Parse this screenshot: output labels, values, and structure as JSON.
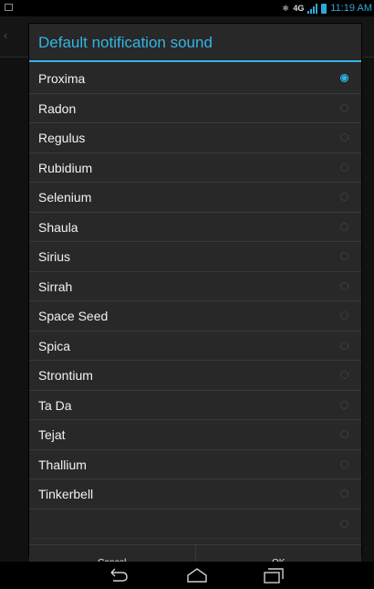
{
  "status_bar": {
    "network_label": "4G",
    "time": "11:19 AM",
    "accent_color": "#33b5e5"
  },
  "dialog": {
    "title": "Default notification sound",
    "items": [
      {
        "label": "Proxima",
        "selected": true
      },
      {
        "label": "Radon",
        "selected": false
      },
      {
        "label": "Regulus",
        "selected": false
      },
      {
        "label": "Rubidium",
        "selected": false
      },
      {
        "label": "Selenium",
        "selected": false
      },
      {
        "label": "Shaula",
        "selected": false
      },
      {
        "label": "Sirius",
        "selected": false
      },
      {
        "label": "Sirrah",
        "selected": false
      },
      {
        "label": "Space Seed",
        "selected": false
      },
      {
        "label": "Spica",
        "selected": false
      },
      {
        "label": "Strontium",
        "selected": false
      },
      {
        "label": "Ta Da",
        "selected": false
      },
      {
        "label": "Tejat",
        "selected": false
      },
      {
        "label": "Thallium",
        "selected": false
      },
      {
        "label": "Tinkerbell",
        "selected": false
      },
      {
        "label": "",
        "selected": false
      }
    ],
    "cancel_label": "Cancel",
    "ok_label": "OK"
  },
  "nav_bar": {
    "icons": [
      "back-icon",
      "home-icon",
      "recent-apps-icon"
    ]
  }
}
